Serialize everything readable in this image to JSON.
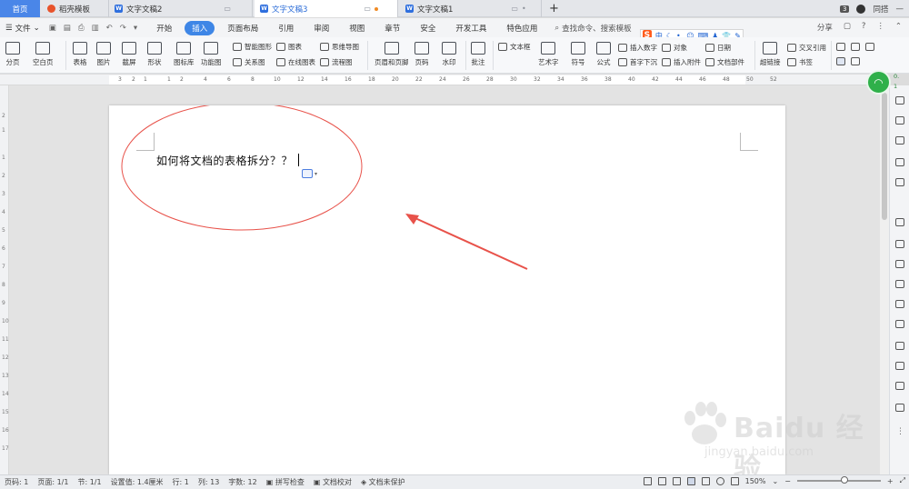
{
  "tabs": {
    "home": "首页",
    "items": [
      {
        "label": "稻壳模板",
        "icon": "docer-icon"
      },
      {
        "label": "文字文稿2",
        "icon": "writer-doc-icon"
      },
      {
        "label": "文字文稿3",
        "icon": "writer-doc-icon",
        "active": true
      },
      {
        "label": "文字文稿1",
        "icon": "writer-doc-icon"
      }
    ],
    "new_tab": "+",
    "badge": "3",
    "user": "同搭"
  },
  "menubar": {
    "file": "文件",
    "tabs": [
      "开始",
      "插入",
      "页面布局",
      "引用",
      "审阅",
      "视图",
      "章节",
      "安全",
      "开发工具",
      "特色应用"
    ],
    "active_tab": "插入",
    "search": "查找命令、搜索模板",
    "share": "分享",
    "help": "?"
  },
  "ribbon": {
    "big": [
      {
        "label": "分页"
      },
      {
        "label": "空白页"
      },
      {
        "label": "表格"
      },
      {
        "label": "图片"
      },
      {
        "label": "截屏"
      },
      {
        "label": "形状"
      },
      {
        "label": "图标库"
      },
      {
        "label": "功能图"
      },
      {
        "label": "页眉和页脚"
      },
      {
        "label": "页码"
      },
      {
        "label": "水印"
      },
      {
        "label": "批注"
      },
      {
        "label": "艺术字"
      },
      {
        "label": "符号"
      },
      {
        "label": "公式"
      },
      {
        "label": "超链接"
      }
    ],
    "small": {
      "smart_shape": "智能图形",
      "chart": "图表",
      "mind_map": "思维导图",
      "relation_map": "关系图",
      "online_chart": "在线图表",
      "flowchart": "流程图",
      "textbox": "文本框",
      "insert_number": "插入数字",
      "object": "对象",
      "date": "日期",
      "dropcap": "首字下沉",
      "attachment": "插入附件",
      "doc_parts": "文档部件",
      "crossref": "交叉引用",
      "bookmark": "书签"
    }
  },
  "ime": {
    "logo": "S",
    "mode": "中"
  },
  "ruler": {
    "h_ticks": [
      "3",
      "2",
      "1",
      "1",
      "2",
      "4",
      "6",
      "8",
      "10",
      "12",
      "14",
      "16",
      "18",
      "20",
      "22",
      "24",
      "26",
      "28",
      "30",
      "32",
      "34",
      "36",
      "38",
      "40",
      "42",
      "44",
      "46",
      "48",
      "50",
      "52"
    ],
    "v_ticks": [
      "2",
      "1",
      "1",
      "2",
      "3",
      "4",
      "5",
      "6",
      "7",
      "8",
      "9",
      "10",
      "11",
      "12",
      "13",
      "14",
      "15",
      "16",
      "17"
    ]
  },
  "document": {
    "text": "如何将文档的表格拆分？？"
  },
  "annotation": {
    "ellipse_color": "#e8524a",
    "arrow_color": "#e8524a"
  },
  "network": {
    "down": "0.",
    "up": "1"
  },
  "statusbar": {
    "page_no": "页码: 1",
    "page": "页面: 1/1",
    "section": "节: 1/1",
    "position": "设置值: 1.4厘米",
    "row": "行: 1",
    "col": "列: 13",
    "words": "字数: 12",
    "spell": "拼写检查",
    "proof": "文档校对",
    "protect": "文档未保护",
    "zoom": "150%",
    "zoom_minus": "−",
    "zoom_plus": "+"
  },
  "watermark": {
    "brand": "Baidu 经验",
    "url": "jingyan.baidu.com"
  }
}
